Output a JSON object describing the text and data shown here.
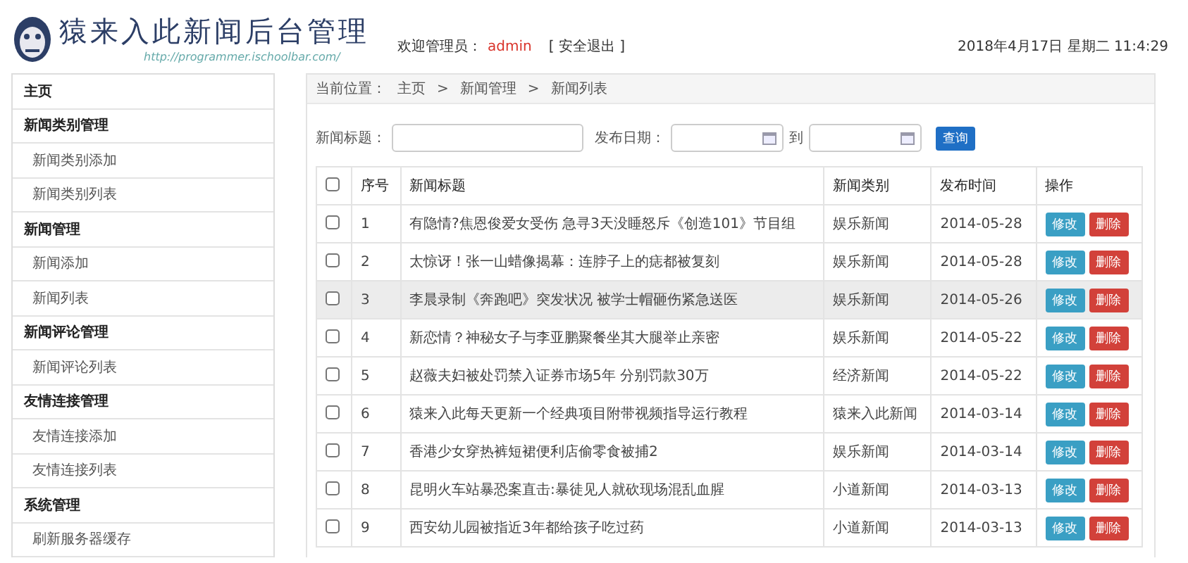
{
  "header": {
    "title": "猿来入此新闻后台管理",
    "url": "http://programmer.ischoolbar.com/",
    "welcome": "欢迎管理员：",
    "user": "admin",
    "logout": "[ 安全退出 ]",
    "datetime": "2018年4月17日 星期二 11:4:29"
  },
  "sidebar": {
    "items": [
      {
        "label": "主页",
        "kind": "group"
      },
      {
        "label": "新闻类别管理",
        "kind": "group"
      },
      {
        "label": "新闻类别添加",
        "kind": "link"
      },
      {
        "label": "新闻类别列表",
        "kind": "link"
      },
      {
        "label": "新闻管理",
        "kind": "group"
      },
      {
        "label": "新闻添加",
        "kind": "link"
      },
      {
        "label": "新闻列表",
        "kind": "link"
      },
      {
        "label": "新闻评论管理",
        "kind": "group"
      },
      {
        "label": "新闻评论列表",
        "kind": "link"
      },
      {
        "label": "友情连接管理",
        "kind": "group"
      },
      {
        "label": "友情连接添加",
        "kind": "link"
      },
      {
        "label": "友情连接列表",
        "kind": "link"
      },
      {
        "label": "系统管理",
        "kind": "group"
      },
      {
        "label": "刷新服务器缓存",
        "kind": "link"
      }
    ]
  },
  "breadcrumb": {
    "label": "当前位置：",
    "items": [
      "主页",
      "新闻管理",
      "新闻列表"
    ],
    "separator": ">"
  },
  "search": {
    "title_label": "新闻标题：",
    "date_label": "发布日期：",
    "to_label": "到",
    "button": "查询"
  },
  "table": {
    "select_all_checked": false,
    "columns": [
      "序号",
      "新闻标题",
      "新闻类别",
      "发布时间",
      "操作"
    ],
    "rows": [
      {
        "no": "1",
        "title": "有隐情?焦恩俊爱女受伤 急寻3天没睡怒斥《创造101》节目组",
        "category": "娱乐新闻",
        "date": "2014-05-28",
        "checked": false,
        "highlighted": false,
        "edit": "修改",
        "delete": "删除"
      },
      {
        "no": "2",
        "title": "太惊讶！张一山蜡像揭幕：连脖子上的痣都被复刻",
        "category": "娱乐新闻",
        "date": "2014-05-28",
        "checked": false,
        "highlighted": false,
        "edit": "修改",
        "delete": "删除"
      },
      {
        "no": "3",
        "title": "李晨录制《奔跑吧》突发状况 被学士帽砸伤紧急送医",
        "category": "娱乐新闻",
        "date": "2014-05-26",
        "checked": false,
        "highlighted": true,
        "edit": "修改",
        "delete": "删除"
      },
      {
        "no": "4",
        "title": "新恋情？神秘女子与李亚鹏聚餐坐其大腿举止亲密",
        "category": "娱乐新闻",
        "date": "2014-05-22",
        "checked": false,
        "highlighted": false,
        "edit": "修改",
        "delete": "删除"
      },
      {
        "no": "5",
        "title": "赵薇夫妇被处罚禁入证券市场5年 分别罚款30万",
        "category": "经济新闻",
        "date": "2014-05-22",
        "checked": false,
        "highlighted": false,
        "edit": "修改",
        "delete": "删除"
      },
      {
        "no": "6",
        "title": "猿来入此每天更新一个经典项目附带视频指导运行教程",
        "category": "猿来入此新闻",
        "date": "2014-03-14",
        "checked": false,
        "highlighted": false,
        "edit": "修改",
        "delete": "删除"
      },
      {
        "no": "7",
        "title": "香港少女穿热裤短裙便利店偷零食被捕2",
        "category": "娱乐新闻",
        "date": "2014-03-14",
        "checked": false,
        "highlighted": false,
        "edit": "修改",
        "delete": "删除"
      },
      {
        "no": "8",
        "title": "昆明火车站暴恐案直击:暴徒见人就砍现场混乱血腥",
        "category": "小道新闻",
        "date": "2014-03-13",
        "checked": false,
        "highlighted": false,
        "edit": "修改",
        "delete": "删除"
      },
      {
        "no": "9",
        "title": "西安幼儿园被指近3年都给孩子吃过药",
        "category": "小道新闻",
        "date": "2014-03-13",
        "checked": false,
        "highlighted": false,
        "edit": "修改",
        "delete": "删除"
      }
    ]
  }
}
